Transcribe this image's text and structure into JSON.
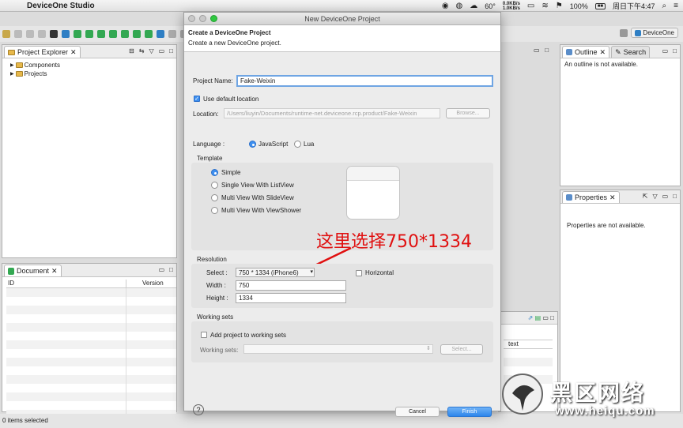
{
  "menubar": {
    "app_name": "DeviceOne Studio",
    "weather": "60°",
    "net_up": "0.0KB/s",
    "net_down": "1.0KB/s",
    "battery": "100%",
    "clock": "周日下午4:47"
  },
  "toolbar": {
    "perspective_label": "DeviceOne"
  },
  "project_explorer": {
    "title": "Project Explorer",
    "items": [
      {
        "label": "Components"
      },
      {
        "label": "Projects"
      }
    ]
  },
  "document": {
    "title": "Document",
    "columns": [
      "ID",
      "Version"
    ]
  },
  "outline": {
    "title": "Outline",
    "search_tab": "Search",
    "message": "An outline is not available."
  },
  "properties": {
    "title": "Properties",
    "message": "Properties are not available."
  },
  "bg_table": {
    "column": "text"
  },
  "statusbar": {
    "text": "0 items selected"
  },
  "dialog": {
    "window_title": "New DeviceOne Project",
    "heading": "Create a DeviceOne Project",
    "subheading": "Create a new DeviceOne project.",
    "project_name_label": "Project Name:",
    "project_name_value": "Fake-Weixin",
    "use_default_label": "Use default location",
    "location_label": "Location:",
    "location_value": "/Users/liuyin/Documents/runtime-net.deviceone.rcp.product/Fake-Weixin",
    "browse_label": "Browse...",
    "language_label": "Language :",
    "lang_js": "JavaScript",
    "lang_lua": "Lua",
    "template_label": "Template",
    "templates": [
      {
        "label": "Simple",
        "selected": true
      },
      {
        "label": "Single View With ListView",
        "selected": false
      },
      {
        "label": "Multi View With SlideView",
        "selected": false
      },
      {
        "label": "Multi View With ViewShower",
        "selected": false
      }
    ],
    "annotation": "这里选择750*1334",
    "resolution_label": "Resolution",
    "select_label": "Select :",
    "select_value": "750 * 1334 (iPhone6)",
    "horizontal_label": "Horizontal",
    "width_label": "Width :",
    "width_value": "750",
    "height_label": "Height :",
    "height_value": "1334",
    "working_sets_group": "Working sets",
    "add_to_ws_label": "Add project to working sets",
    "working_sets_label": "Working sets:",
    "ws_select_label": "Select...",
    "cancel_label": "Cancel",
    "finish_label": "Finish",
    "help_label": "?"
  },
  "watermark": {
    "cn": "黑区网络",
    "url": "www.heiqu.com"
  },
  "colors": {
    "accent": "#3d8ff0",
    "annotation": "#e01010",
    "finish_btn": "#2c86ec"
  }
}
